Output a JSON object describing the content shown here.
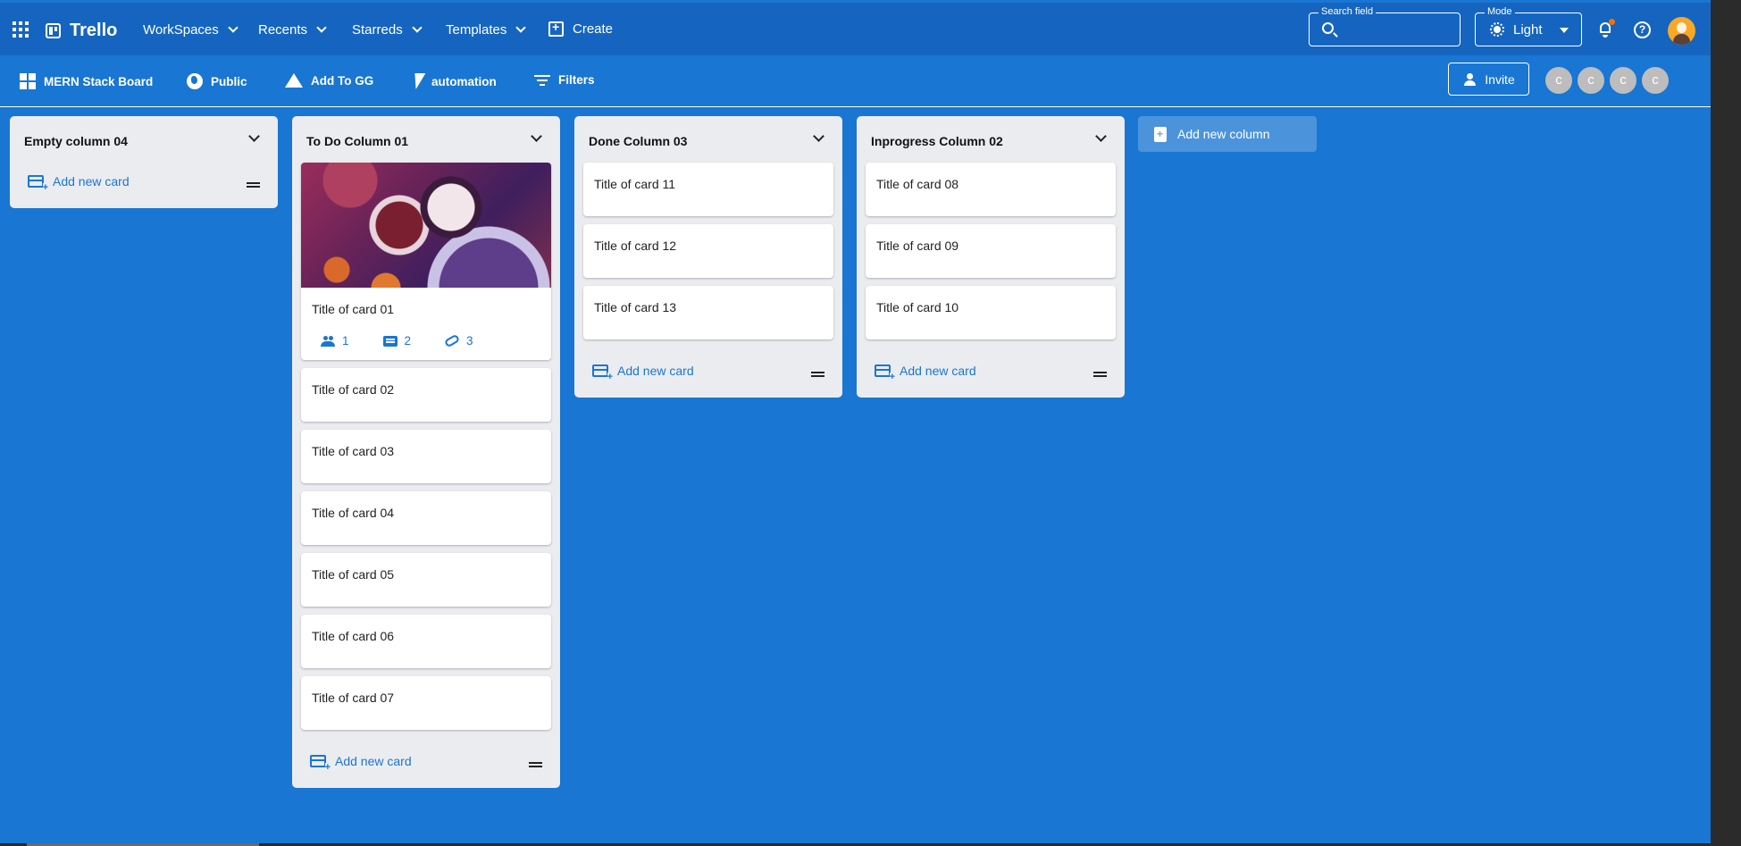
{
  "app": {
    "name": "Trello",
    "nav": [
      "WorkSpaces",
      "Recents",
      "Starreds",
      "Templates"
    ],
    "create_label": "Create",
    "search": {
      "label": "Search field",
      "value": ""
    },
    "mode": {
      "label": "Mode",
      "value": "Light"
    }
  },
  "board": {
    "title": "MERN Stack Board",
    "visibility": "Public",
    "add_to_drive": "Add To GG",
    "automation": "automation",
    "filters": "Filters",
    "invite": "Invite",
    "members": [
      "c",
      "c",
      "c",
      "c"
    ]
  },
  "add_card_label": "Add new card",
  "add_column_label": "Add new column",
  "columns": [
    {
      "title": "Empty column 04",
      "cards": []
    },
    {
      "title": "To Do Column 01",
      "cards": [
        {
          "title": "Title of card 01",
          "has_cover": true,
          "members": "1",
          "comments": "2",
          "attachments": "3"
        },
        {
          "title": "Title of card 02"
        },
        {
          "title": "Title of card 03"
        },
        {
          "title": "Title of card 04"
        },
        {
          "title": "Title of card 05"
        },
        {
          "title": "Title of card 06"
        },
        {
          "title": "Title of card 07"
        }
      ]
    },
    {
      "title": "Done Column 03",
      "cards": [
        {
          "title": "Title of card 11"
        },
        {
          "title": "Title of card 12"
        },
        {
          "title": "Title of card 13"
        }
      ]
    },
    {
      "title": "Inprogress Column 02",
      "cards": [
        {
          "title": "Title of card 08"
        },
        {
          "title": "Title of card 09"
        },
        {
          "title": "Title of card 10"
        }
      ]
    }
  ],
  "colors": {
    "primary": "#1976d2",
    "appbar": "#1565c0",
    "column_bg": "#ebecf0",
    "notification_dot": "#ff6d00"
  }
}
